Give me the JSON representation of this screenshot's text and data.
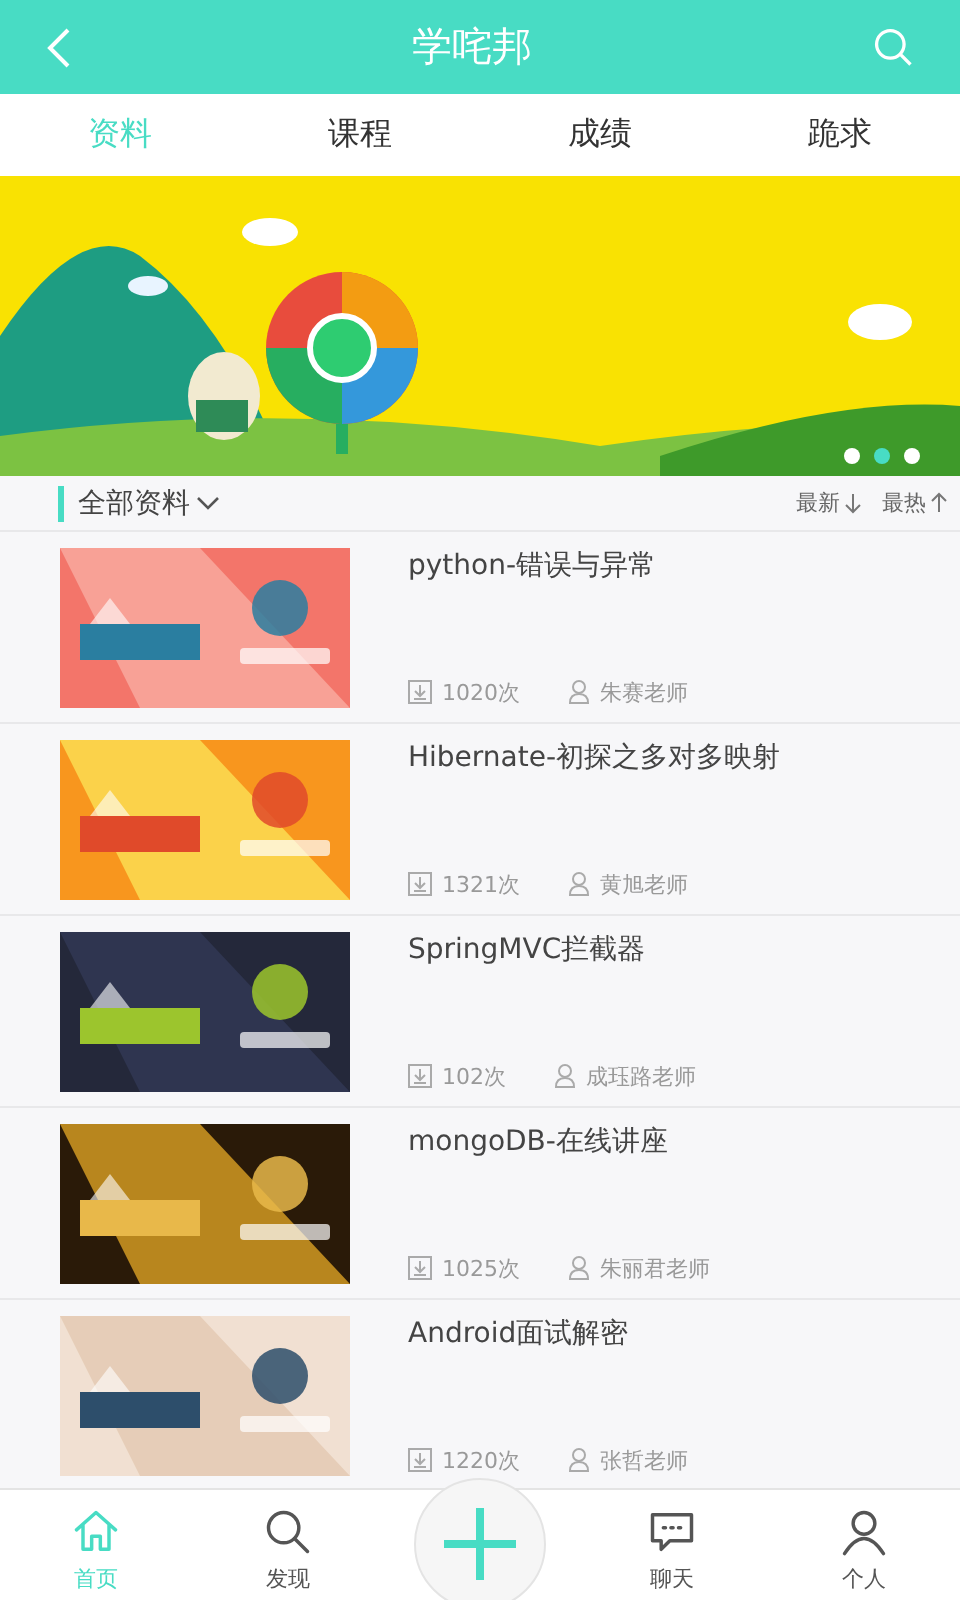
{
  "header": {
    "title": "学咤邦"
  },
  "tabs": [
    {
      "label": "资料",
      "selected": true
    },
    {
      "label": "课程",
      "selected": false
    },
    {
      "label": "成绩",
      "selected": false
    },
    {
      "label": "跪求",
      "selected": false
    }
  ],
  "banner": {
    "kind": "picture",
    "dots": [
      {
        "selected": false
      },
      {
        "selected": true
      },
      {
        "selected": false
      }
    ]
  },
  "filter": {
    "label": "全部资料",
    "sorts": [
      {
        "label": "最新",
        "kind": "descending"
      },
      {
        "label": "最热",
        "kind": "ascending"
      }
    ]
  },
  "items": [
    {
      "title": "python-错误与异常",
      "downloads": "1020次",
      "teacher": "朱赛老师"
    },
    {
      "title": "Hibernate-初探之多对多映射",
      "downloads": "1321次",
      "teacher": "黄旭老师"
    },
    {
      "title": "SpringMVC拦截器",
      "downloads": "102次",
      "teacher": "成珏路老师"
    },
    {
      "title": "mongoDB-在线讲座",
      "downloads": "1025次",
      "teacher": "朱丽君老师"
    },
    {
      "title": "Android面试解密",
      "downloads": "1220次",
      "teacher": "张哲老师"
    }
  ],
  "nav": [
    {
      "kind": "home",
      "label": "首页",
      "selected": true
    },
    {
      "kind": "discover",
      "label": "发现",
      "selected": false
    },
    {
      "kind": "add"
    },
    {
      "kind": "chat",
      "label": "聊天",
      "selected": false
    },
    {
      "kind": "profile",
      "label": "个人",
      "selected": false
    }
  ]
}
